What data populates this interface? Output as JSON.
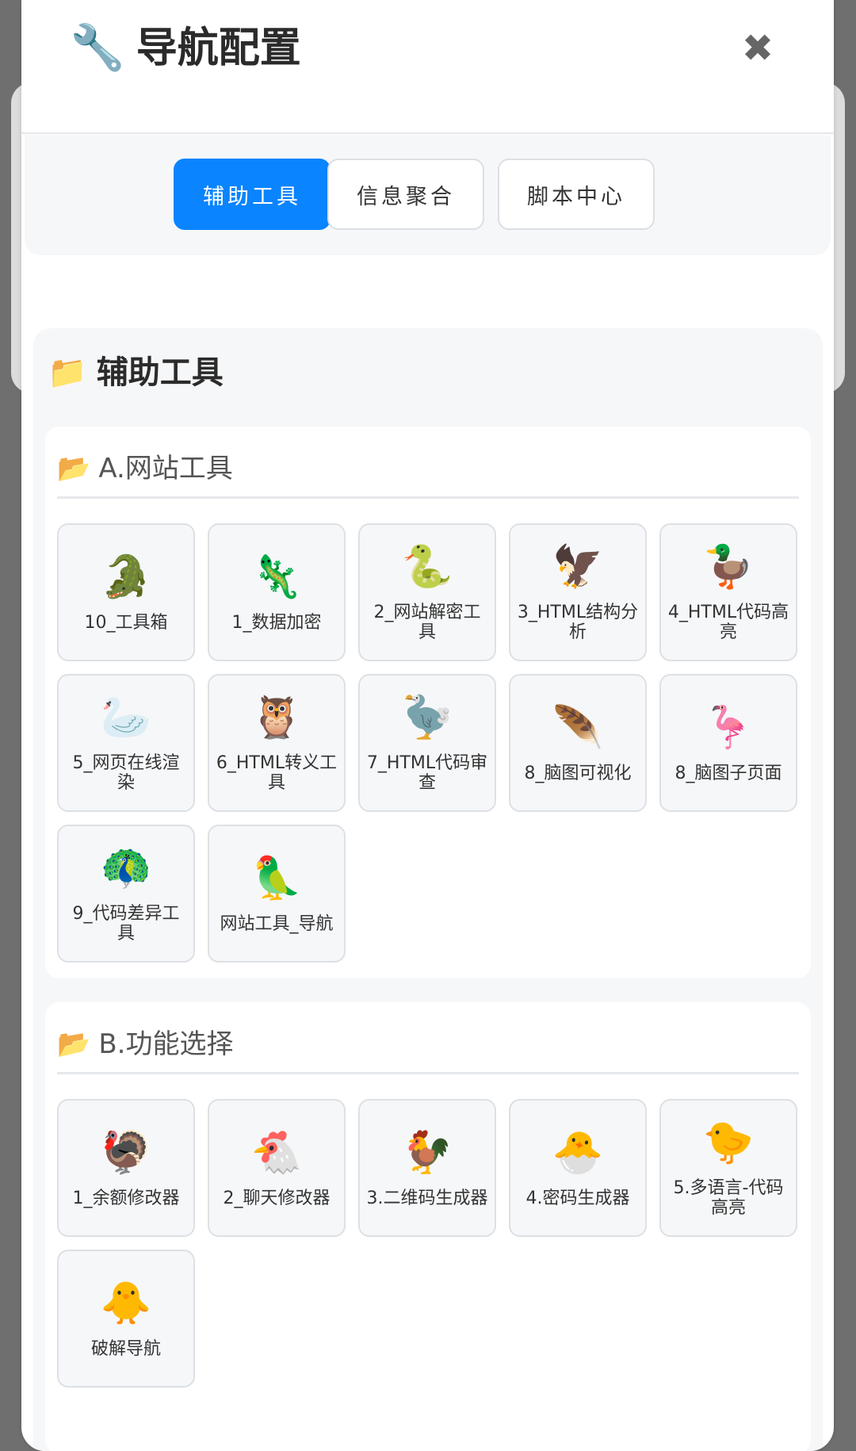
{
  "header": {
    "icon": "🔧",
    "title": "导航配置",
    "close": "✖"
  },
  "tabs": [
    {
      "label": "辅助工具",
      "active": true
    },
    {
      "label": "信息聚合",
      "active": false
    },
    {
      "label": "脚本中心",
      "active": false
    }
  ],
  "section": {
    "icon": "📁",
    "title": "辅助工具"
  },
  "groups": [
    {
      "icon": "📂",
      "title": "A.网站工具",
      "items": [
        {
          "icon": "🐊",
          "label": "10_工具箱"
        },
        {
          "icon": "🦎",
          "label": "1_数据加密"
        },
        {
          "icon": "🐍",
          "label": "2_网站解密工具"
        },
        {
          "icon": "🦅",
          "label": "3_HTML结构分析"
        },
        {
          "icon": "🦆",
          "label": "4_HTML代码高亮"
        },
        {
          "icon": "🦢",
          "label": "5_网页在线渲染"
        },
        {
          "icon": "🦉",
          "label": "6_HTML转义工具"
        },
        {
          "icon": "🦤",
          "label": "7_HTML代码审查"
        },
        {
          "icon": "🪶",
          "label": "8_脑图可视化"
        },
        {
          "icon": "🦩",
          "label": "8_脑图子页面"
        },
        {
          "icon": "🦚",
          "label": "9_代码差异工具"
        },
        {
          "icon": "🦜",
          "label": "网站工具_导航"
        }
      ]
    },
    {
      "icon": "📂",
      "title": "B.功能选择",
      "items": [
        {
          "icon": "🦃",
          "label": "1_余额修改器"
        },
        {
          "icon": "🐔",
          "label": "2_聊天修改器"
        },
        {
          "icon": "🐓",
          "label": "3.二维码生成器"
        },
        {
          "icon": "🐣",
          "label": "4.密码生成器"
        },
        {
          "icon": "🐤",
          "label": "5.多语言-代码高亮"
        },
        {
          "icon": "🐥",
          "label": "破解导航"
        }
      ]
    }
  ],
  "colors": {
    "accent": "#0a84ff",
    "overlay": "#6f6f6f",
    "panel": "#f6f7f9"
  }
}
